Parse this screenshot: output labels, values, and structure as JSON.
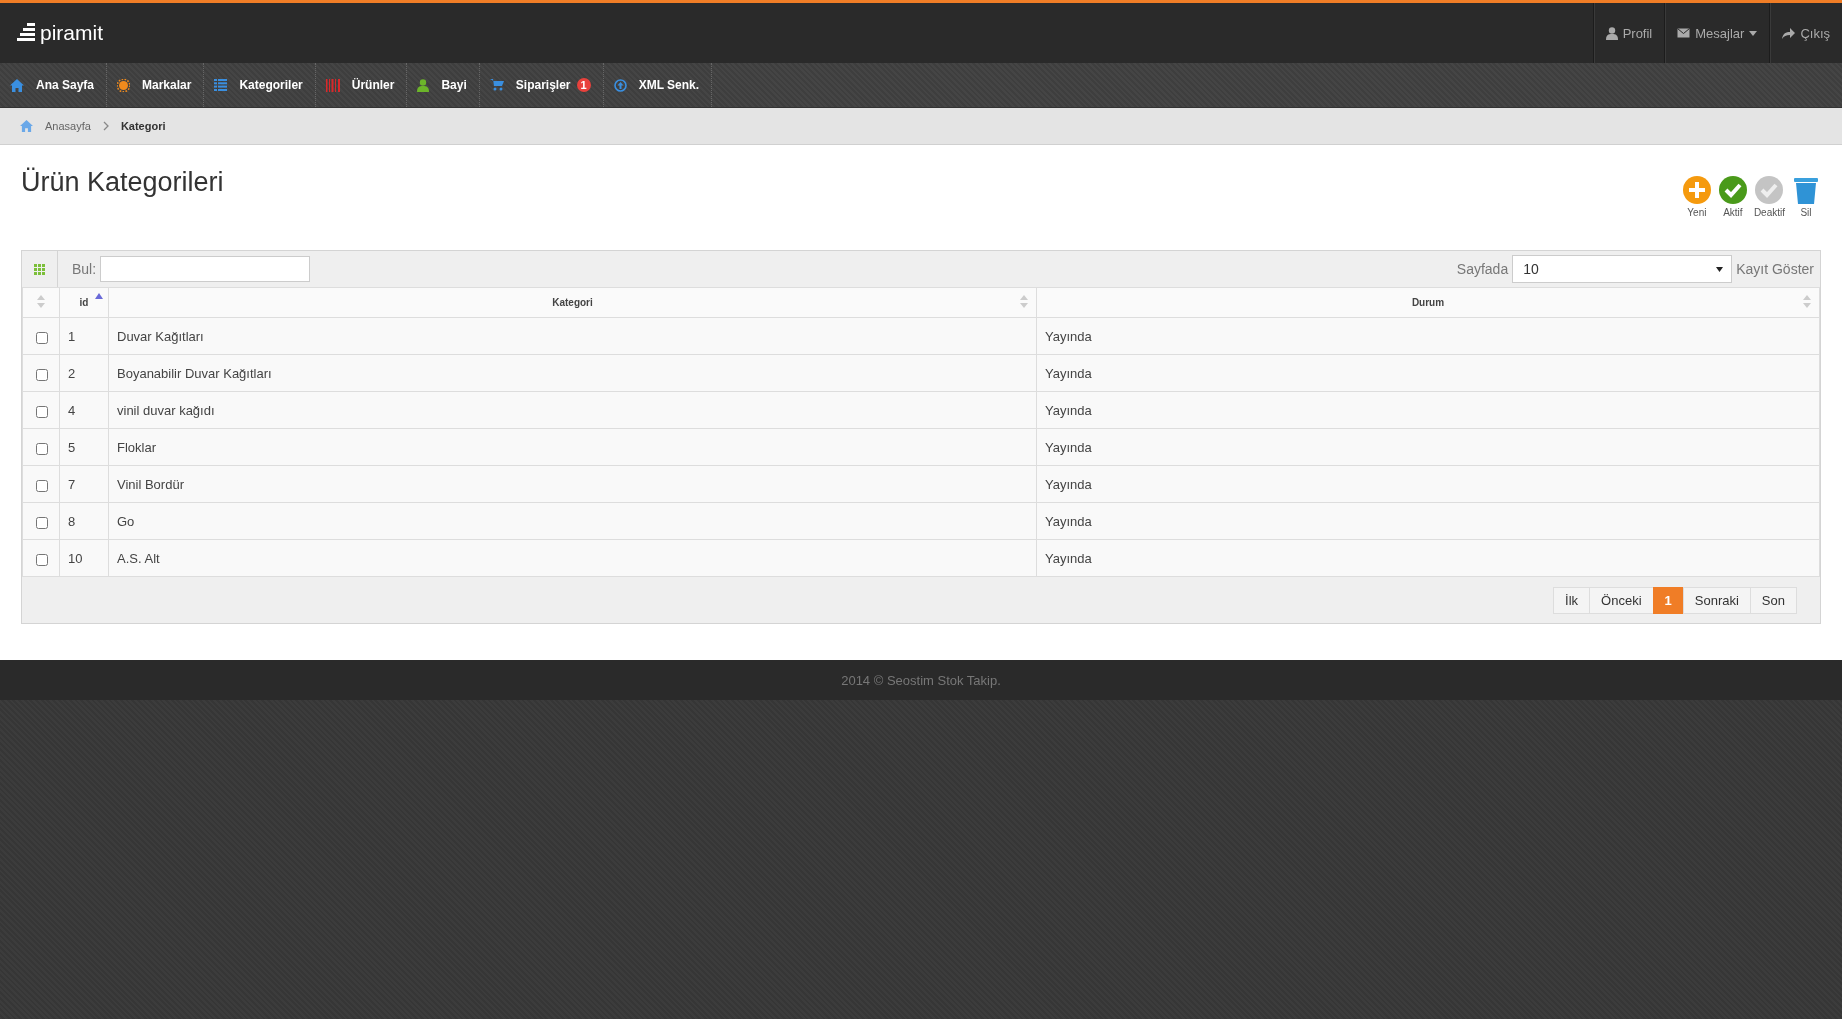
{
  "brand": "piramit",
  "user_menu": [
    {
      "label": "Profil",
      "dropdown": false
    },
    {
      "label": "Mesajlar",
      "dropdown": true
    },
    {
      "label": "Çıkış",
      "dropdown": false
    }
  ],
  "nav": [
    {
      "label": "Ana Sayfa"
    },
    {
      "label": "Markalar"
    },
    {
      "label": "Kategoriler"
    },
    {
      "label": "Ürünler"
    },
    {
      "label": "Bayi"
    },
    {
      "label": "Siparişler",
      "badge": "1"
    },
    {
      "label": "XML Senk."
    }
  ],
  "breadcrumb": [
    {
      "label": "Anasayfa",
      "current": false
    },
    {
      "label": "Kategori",
      "current": true
    }
  ],
  "page_title": "Ürün Kategorileri",
  "actions": [
    {
      "label": "Yeni"
    },
    {
      "label": "Aktif"
    },
    {
      "label": "Deaktif"
    },
    {
      "label": "Sil"
    }
  ],
  "toolbar": {
    "search_label": "Bul:",
    "per_page_label": "Sayfada",
    "per_page_value": "10",
    "per_page_suffix": "Kayıt Göster"
  },
  "columns": [
    {
      "label": "id",
      "sorted": true
    },
    {
      "label": "Kategori",
      "sorted": false
    },
    {
      "label": "Durum",
      "sorted": false
    }
  ],
  "rows": [
    {
      "checked": false,
      "id": "1",
      "kategori": "Duvar Kağıtları",
      "durum": "Yayında"
    },
    {
      "checked": false,
      "id": "2",
      "kategori": "Boyanabilir Duvar Kağıtları",
      "durum": "Yayında"
    },
    {
      "checked": false,
      "id": "4",
      "kategori": "vinil duvar kağıdı",
      "durum": "Yayında"
    },
    {
      "checked": false,
      "id": "5",
      "kategori": "Floklar",
      "durum": "Yayında"
    },
    {
      "checked": false,
      "id": "7",
      "kategori": "Vinil Bordür",
      "durum": "Yayında"
    },
    {
      "checked": false,
      "id": "8",
      "kategori": "Go",
      "durum": "Yayında"
    },
    {
      "checked": false,
      "id": "10",
      "kategori": "A.S. Alt",
      "durum": "Yayında"
    }
  ],
  "pagination": [
    {
      "label": "İlk",
      "selected": false
    },
    {
      "label": "Önceki",
      "selected": false
    },
    {
      "label": "1",
      "selected": true
    },
    {
      "label": "Sonraki",
      "selected": false
    },
    {
      "label": "Son",
      "selected": false
    }
  ],
  "footer": "2014 © Seostim Stok Takip."
}
